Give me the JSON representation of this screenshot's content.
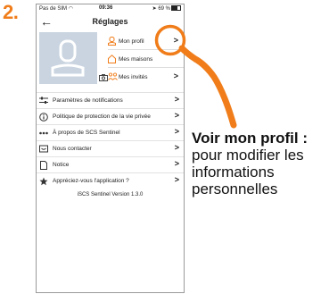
{
  "step_number": "2.",
  "status_bar": {
    "carrier": "Pas de SIM",
    "time": "09:36",
    "battery": "69 %"
  },
  "nav": {
    "title": "Réglages"
  },
  "profile_menu": [
    {
      "label": "Mon profil",
      "icon": "user-icon"
    },
    {
      "label": "Mes maisons",
      "icon": "house-icon"
    },
    {
      "label": "Mes invités",
      "icon": "guests-icon"
    }
  ],
  "settings": [
    {
      "label": "Paramètres de notifications",
      "icon": "sliders-icon"
    },
    {
      "label": "Politique de protection de la vie privée",
      "icon": "info-icon"
    },
    {
      "label": "À propos de SCS Sentinel",
      "icon": "dots-icon"
    },
    {
      "label": "Nous contacter",
      "icon": "message-icon"
    },
    {
      "label": "Notice",
      "icon": "document-icon"
    },
    {
      "label": "Appréciez-vous l'application ?",
      "icon": "star-icon"
    }
  ],
  "version": "iSCS Sentinel Version 1.3.0",
  "callout": {
    "title": "Voir mon profil :",
    "body": "pour modifier les informations personnelles"
  },
  "colors": {
    "accent": "#F07D1A",
    "avatar_bg": "#c9d4e0",
    "avatar_fg": "#ffffff"
  }
}
